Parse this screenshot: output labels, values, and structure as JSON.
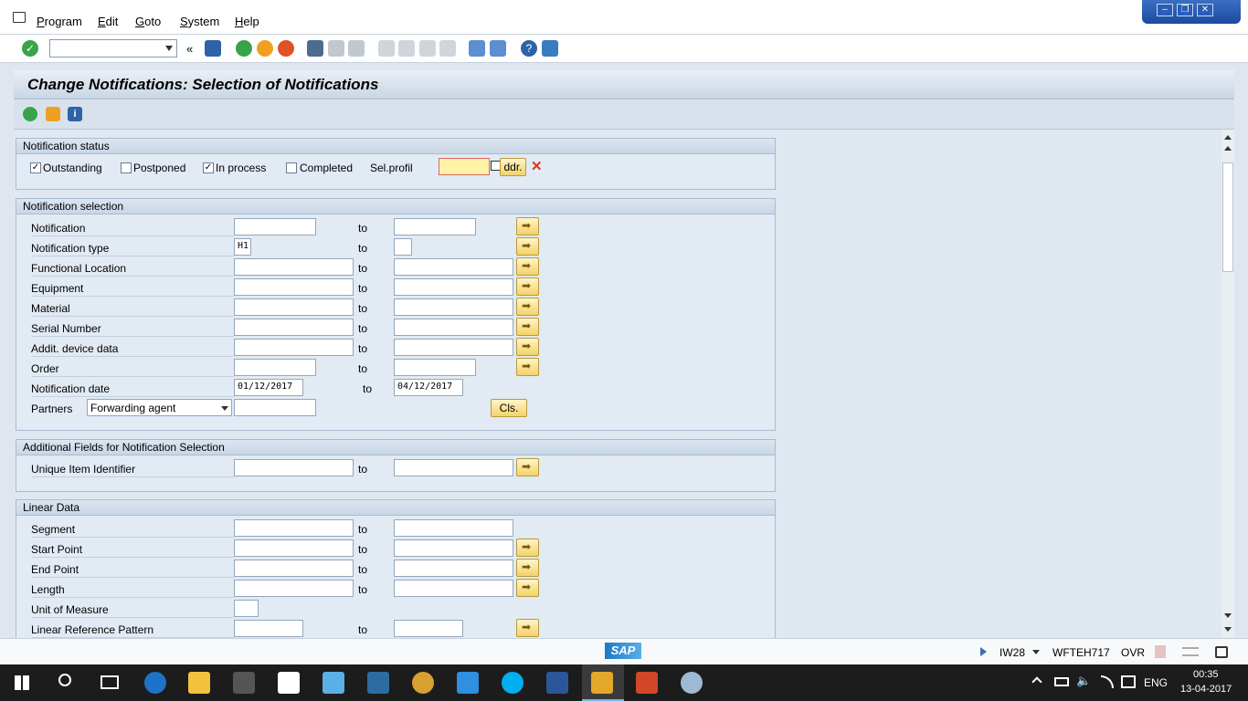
{
  "menu": [
    "Program",
    "Edit",
    "Goto",
    "System",
    "Help"
  ],
  "title": "Change Notifications: Selection of Notifications",
  "status_group": {
    "title": "Notification status",
    "checks": [
      {
        "label": "Outstanding",
        "checked": true
      },
      {
        "label": "Postponed",
        "checked": false
      },
      {
        "label": "In process",
        "checked": true
      },
      {
        "label": "Completed",
        "checked": false
      }
    ],
    "sel_profile_label": "Sel.profil",
    "addr_button": "ddr."
  },
  "selection_group": {
    "title": "Notification selection",
    "to_label": "to",
    "rows": [
      {
        "label": "Notification",
        "from": "",
        "to": ""
      },
      {
        "label": "Notification type",
        "from": "H1",
        "to": ""
      },
      {
        "label": "Functional Location",
        "from": "",
        "to": ""
      },
      {
        "label": "Equipment",
        "from": "",
        "to": ""
      },
      {
        "label": "Material",
        "from": "",
        "to": ""
      },
      {
        "label": "Serial Number",
        "from": "",
        "to": ""
      },
      {
        "label": "Addit. device data",
        "from": "",
        "to": ""
      },
      {
        "label": "Order",
        "from": "",
        "to": ""
      },
      {
        "label": "Notification date",
        "from": "01/12/2017",
        "to": "04/12/2017"
      }
    ],
    "partners_label": "Partners",
    "partners_value": "Forwarding agent",
    "cls_button": "Cls."
  },
  "additional_group": {
    "title": "Additional Fields for Notification Selection",
    "rows": [
      {
        "label": "Unique Item Identifier"
      }
    ]
  },
  "linear_group": {
    "title": "Linear Data",
    "rows": [
      {
        "label": "Segment"
      },
      {
        "label": "Start Point"
      },
      {
        "label": "End Point"
      },
      {
        "label": "Length"
      },
      {
        "label": "Unit of Measure"
      },
      {
        "label": "Linear Reference Pattern"
      }
    ]
  },
  "status_bar": {
    "transaction": "IW28",
    "server": "WFTEH717",
    "mode": "OVR",
    "logo": "SAP"
  },
  "taskbar": {
    "language": "ENG",
    "time": "00:35",
    "date": "13-04-2017"
  },
  "colors": {
    "accent_yellow": "#f3d26a",
    "title_gradient": "#c9d6e4",
    "taskbar": "#1c1c1c"
  }
}
